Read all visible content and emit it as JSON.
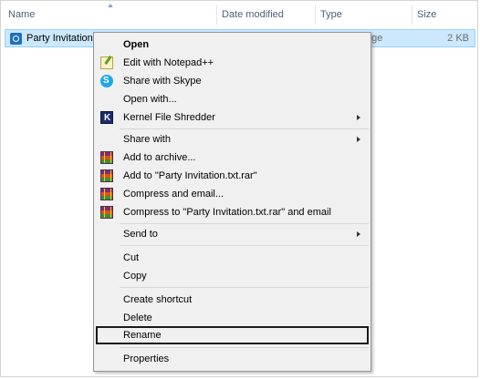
{
  "columns": {
    "name": "Name",
    "date_modified": "Date modified",
    "type": "Type",
    "size": "Size"
  },
  "file": {
    "name": "Party Invitation.txt",
    "type_visible": "age",
    "size": "2 KB",
    "icon": "outlook-item-icon"
  },
  "menu": {
    "open": "Open",
    "edit_notepad": "Edit with Notepad++",
    "share_skype": "Share with Skype",
    "open_with": "Open with...",
    "kernel_shredder": "Kernel File Shredder",
    "share_with": "Share with",
    "add_archive": "Add to archive...",
    "add_rar": "Add to \"Party Invitation.txt.rar\"",
    "compress_email": "Compress and email...",
    "compress_rar_email": "Compress to \"Party Invitation.txt.rar\" and email",
    "send_to": "Send to",
    "cut": "Cut",
    "copy": "Copy",
    "create_shortcut": "Create shortcut",
    "delete": "Delete",
    "rename": "Rename",
    "properties": "Properties"
  },
  "colors": {
    "selection_bg": "#cce8ff",
    "selection_border": "#99d1ff",
    "menu_bg": "#f0f0f0",
    "header_text": "#4c607a"
  }
}
